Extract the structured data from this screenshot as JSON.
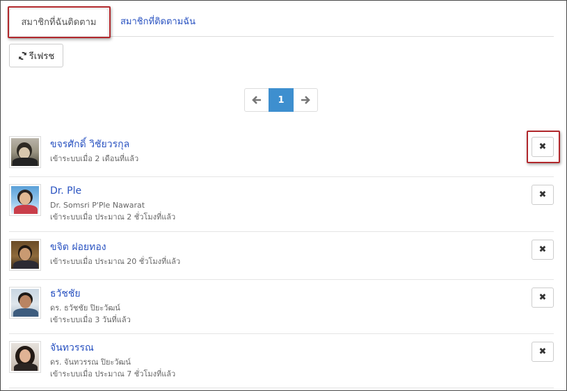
{
  "tabs": {
    "following_label": "สมาชิกที่ฉันติดตาม",
    "followers_label": "สมาชิกที่ติดตามฉัน"
  },
  "toolbar": {
    "refresh_label": "รีเฟรช",
    "refresh_icon": "refresh-icon"
  },
  "pagination": {
    "prev_label": "←",
    "current_page": "1",
    "next_label": "→"
  },
  "remove_label": "✖",
  "members": [
    {
      "name": "ขจรศักดิ์ วิชัยวรกุล",
      "subtitle": "",
      "last_login": "เข้าระบบเมื่อ 2 เดือนที่แล้ว"
    },
    {
      "name": "Dr. Ple",
      "subtitle": "Dr. Somsri P'Ple Nawarat",
      "last_login": "เข้าระบบเมื่อ ประมาณ 2 ชั่วโมงที่แล้ว"
    },
    {
      "name": "ขจิต ฝอยทอง",
      "subtitle": "",
      "last_login": "เข้าระบบเมื่อ ประมาณ 20 ชั่วโมงที่แล้ว"
    },
    {
      "name": "ธวัชชัย",
      "subtitle": "ดร. ธวัชชัย ปิยะวัฒน์",
      "last_login": "เข้าระบบเมื่อ 3 วันที่แล้ว"
    },
    {
      "name": "จันทวรรณ",
      "subtitle": "ดร. จันทวรรณ ปิยะวัฒน์",
      "last_login": "เข้าระบบเมื่อ ประมาณ 7 ชั่วโมงที่แล้ว"
    }
  ],
  "colors": {
    "link": "#2a53c1",
    "active_page": "#3e8fcf",
    "highlight": "#b1282c"
  }
}
